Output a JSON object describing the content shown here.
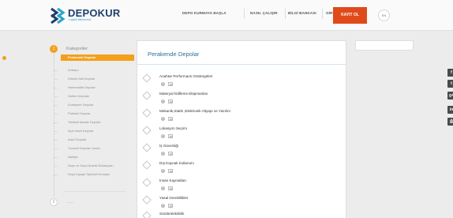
{
  "brand": {
    "name": "DEPOKUR",
    "tagline": "Lojistik Bilmecesiz",
    "colors": {
      "navy": "#1f3f6e",
      "teal": "#2aa6c7",
      "accent_orange": "#f3a01b",
      "cta_red": "#e04a1b"
    }
  },
  "nav": {
    "items": [
      "DEPO KURMAYA BAŞLA",
      "NASIL ÇALIŞIR",
      "BİLGİ BANKASI",
      "GİRİŞ YAP"
    ],
    "signup_label": "KAYIT OL",
    "language": "EN"
  },
  "sidebar": {
    "step1": {
      "number": "1",
      "title": "Kategoriler"
    },
    "step2": {
      "number": "2",
      "title": "......"
    },
    "items": [
      {
        "label": "Perakende Depolar",
        "active": true
      },
      {
        "label": "Antrepo",
        "active": false
      },
      {
        "label": "Dökme Mal Depolar",
        "active": false
      },
      {
        "label": "Hammadde Depolar",
        "active": false
      },
      {
        "label": "Üretim Depoları",
        "active": false
      },
      {
        "label": "Konteyner Depolar",
        "active": false
      },
      {
        "label": "Paletsel Depolar",
        "active": false
      },
      {
        "label": "Tehlikeli Madde Depolar",
        "active": false
      },
      {
        "label": "Açık Hava Depolar",
        "active": false
      },
      {
        "label": "Arşiv Depolar",
        "active": false
      },
      {
        "label": "Transsit Depolar Lisans",
        "active": false
      },
      {
        "label": "Nakliye",
        "active": false
      },
      {
        "label": "Depo ve Depo Arazisi Emlakçıları",
        "active": false
      },
      {
        "label": "Depo İnşaatı Taahhüt Firmaları",
        "active": false
      }
    ]
  },
  "main": {
    "title": "Perakende Depolar",
    "topics": [
      "Anahtar Performans Göstergeleri",
      "Materyal İstifleme Ekipmanları",
      "Mekanik,Statik ,Elektronik Altyapı ve Yazılım",
      "Lokasyon Seçimi",
      "İş Güvenliği",
      "Dış Kaynak Kullanımı",
      "İnsan Kaynakları",
      "Yasal Gereklilikler",
      "Sürdürülebilirlik"
    ]
  },
  "social": {
    "icons": [
      {
        "glyph": "f",
        "icon": "facebook-icon"
      },
      {
        "glyph": "t",
        "icon": "twitter-icon"
      },
      {
        "glyph": "g+",
        "icon": "google-plus-icon"
      },
      {
        "glyph": "in",
        "icon": "linkedin-icon"
      },
      {
        "glyph": "⎙",
        "icon": "print-icon"
      }
    ]
  }
}
